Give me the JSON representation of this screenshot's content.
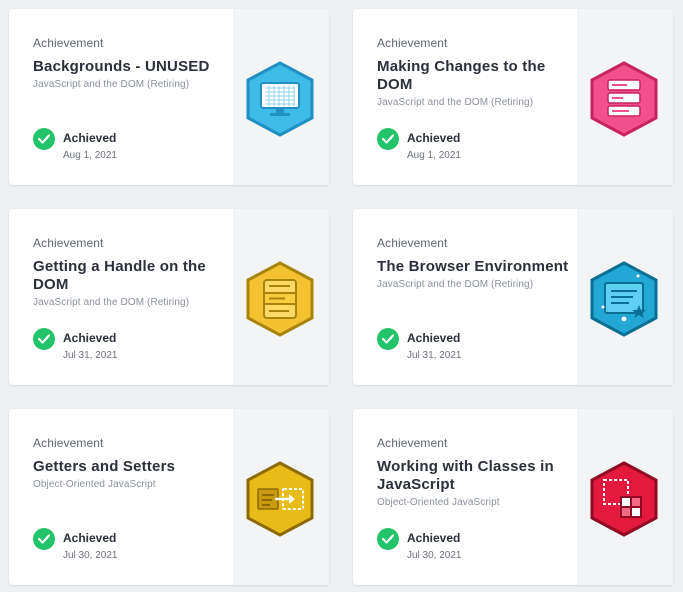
{
  "cards": [
    {
      "eyebrow": "Achievement",
      "title": "Backgrounds - UNUSED",
      "course": "JavaScript and the DOM (Retiring)",
      "status": "Achieved",
      "date": "Aug 1, 2021",
      "badge": {
        "icon": "monitor-icon",
        "color": "#3fbbe8"
      }
    },
    {
      "eyebrow": "Achievement",
      "title": "Making Changes to the DOM",
      "course": "JavaScript and the DOM (Retiring)",
      "status": "Achieved",
      "date": "Aug 1, 2021",
      "badge": {
        "icon": "stacked-list-icon",
        "color": "#f2508c"
      }
    },
    {
      "eyebrow": "Achievement",
      "title": "Getting a Handle on the DOM",
      "course": "JavaScript and the DOM (Retiring)",
      "status": "Achieved",
      "date": "Jul 31, 2021",
      "badge": {
        "icon": "list-box-icon",
        "color": "#f2c230"
      }
    },
    {
      "eyebrow": "Achievement",
      "title": "The Browser Environment",
      "course": "JavaScript and the DOM (Retiring)",
      "status": "Achieved",
      "date": "Jul 31, 2021",
      "badge": {
        "icon": "browser-window-icon",
        "color": "#23a7d6"
      }
    },
    {
      "eyebrow": "Achievement",
      "title": "Getters and Setters",
      "course": "Object-Oriented JavaScript",
      "status": "Achieved",
      "date": "Jul 30, 2021",
      "badge": {
        "icon": "input-arrow-icon",
        "color": "#e7bc19"
      }
    },
    {
      "eyebrow": "Achievement",
      "title": "Working with Classes in JavaScript",
      "course": "Object-Oriented JavaScript",
      "status": "Achieved",
      "date": "Jul 30, 2021",
      "badge": {
        "icon": "class-blocks-icon",
        "color": "#e3193e"
      }
    }
  ]
}
